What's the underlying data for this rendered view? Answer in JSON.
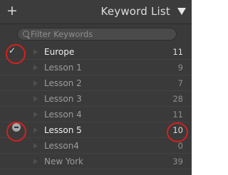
{
  "header": {
    "add_label": "+",
    "title": "Keyword List"
  },
  "search": {
    "placeholder": "Filter Keywords"
  },
  "keywords": [
    {
      "label": "Europe",
      "count": "11",
      "state": "checked"
    },
    {
      "label": "Lesson 1",
      "count": "9",
      "state": "none"
    },
    {
      "label": "Lesson 2",
      "count": "7",
      "state": "none"
    },
    {
      "label": "Lesson 3",
      "count": "28",
      "state": "none"
    },
    {
      "label": "Lesson 4",
      "count": "11",
      "state": "none"
    },
    {
      "label": "Lesson 5",
      "count": "10",
      "state": "partial"
    },
    {
      "label": "Lesson4",
      "count": "0",
      "state": "none"
    },
    {
      "label": "New York",
      "count": "39",
      "state": "none"
    }
  ],
  "annotation_color": "#d91f1f"
}
